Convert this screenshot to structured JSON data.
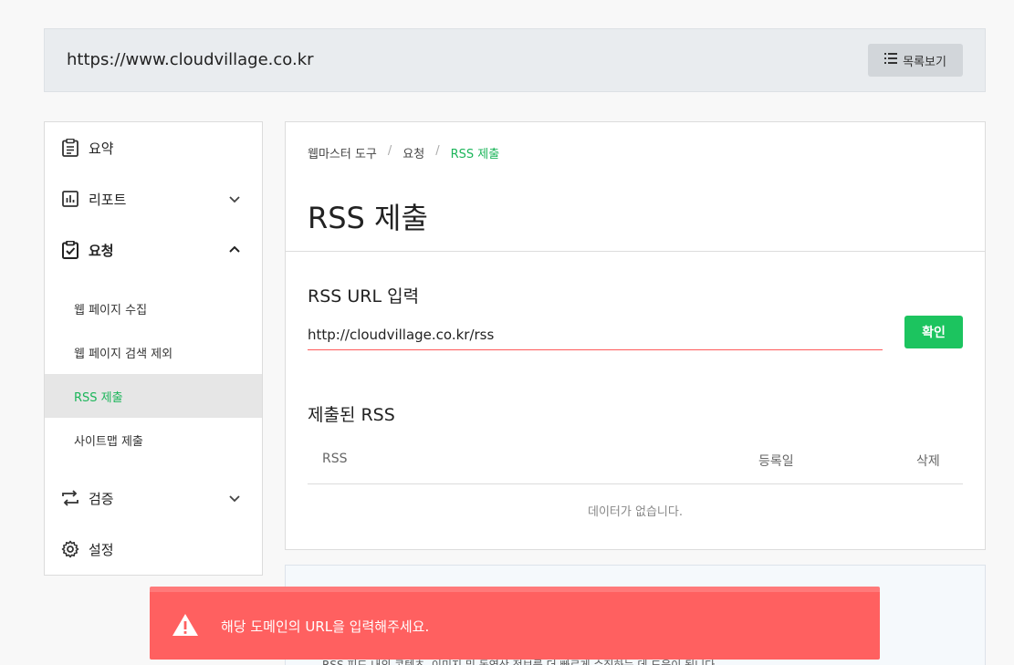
{
  "topbar": {
    "site_url": "https://www.cloudvillage.co.kr",
    "list_button": "목록보기"
  },
  "sidebar": {
    "items": [
      {
        "label": "요약"
      },
      {
        "label": "리포트"
      },
      {
        "label": "요청"
      },
      {
        "label": "검증"
      },
      {
        "label": "설정"
      }
    ],
    "sub_items": [
      {
        "label": "웹 페이지 수집"
      },
      {
        "label": "웹 페이지 검색 제외"
      },
      {
        "label": "RSS 제출"
      },
      {
        "label": "사이트맵 제출"
      }
    ]
  },
  "breadcrumb": {
    "level1": "웹마스터 도구",
    "sep": "/",
    "level2": "요청",
    "level3": "RSS 제출"
  },
  "page": {
    "title": "RSS 제출",
    "input_section_title": "RSS URL 입력",
    "input_value": "http://cloudvillage.co.kr/rss",
    "confirm_label": "확인",
    "submitted_title": "제출된 RSS",
    "table": {
      "col_rss": "RSS",
      "col_date": "등록일",
      "col_delete": "삭제"
    },
    "empty_message": "데이터가 없습니다."
  },
  "lower_card": {
    "text": "RSS 피드 내의 콘텐츠, 이미지 및 동영상 정보를 더 빠르게 수집하는 데 도움이 됩니다."
  },
  "toast": {
    "message": "해당 도메인의 URL을 입력해주세요."
  },
  "colors": {
    "accent_green": "#1cc45f",
    "error_red": "#ff6060"
  }
}
